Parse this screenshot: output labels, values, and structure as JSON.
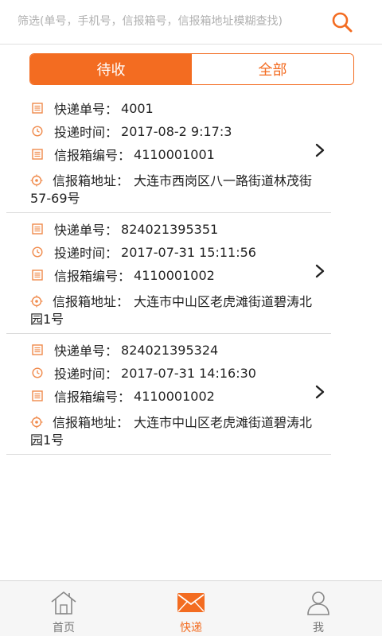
{
  "search": {
    "placeholder": "筛选(单号，手机号，信报箱号，信报箱地址模糊查找)"
  },
  "tabs": [
    {
      "label": "待收",
      "active": true
    },
    {
      "label": "全部",
      "active": false
    }
  ],
  "labels": {
    "tracking_no": "快递单号：",
    "delivery_time": "投递时间：",
    "mailbox_no": "信报箱编号：",
    "mailbox_address": "信报箱地址："
  },
  "items": [
    {
      "tracking_no": "4001",
      "delivery_time": "2017-08-2 9:17:3",
      "mailbox_no": "4110001001",
      "mailbox_address": "大连市西岗区八一路街道林茂街57-69号"
    },
    {
      "tracking_no": "824021395351",
      "delivery_time": "2017-07-31 15:11:56",
      "mailbox_no": "4110001002",
      "mailbox_address": "大连市中山区老虎滩街道碧涛北园1号"
    },
    {
      "tracking_no": "824021395324",
      "delivery_time": "2017-07-31 14:16:30",
      "mailbox_no": "4110001002",
      "mailbox_address": "大连市中山区老虎滩街道碧涛北园1号"
    }
  ],
  "tabbar": [
    {
      "label": "首页",
      "icon": "home-icon",
      "active": false
    },
    {
      "label": "快递",
      "icon": "envelope-icon",
      "active": true
    },
    {
      "label": "我",
      "icon": "user-icon",
      "active": false
    }
  ],
  "colors": {
    "accent": "#f36c21",
    "icon_orange": "#f08a4b",
    "text": "#222222",
    "divider": "#dcdcdc"
  }
}
